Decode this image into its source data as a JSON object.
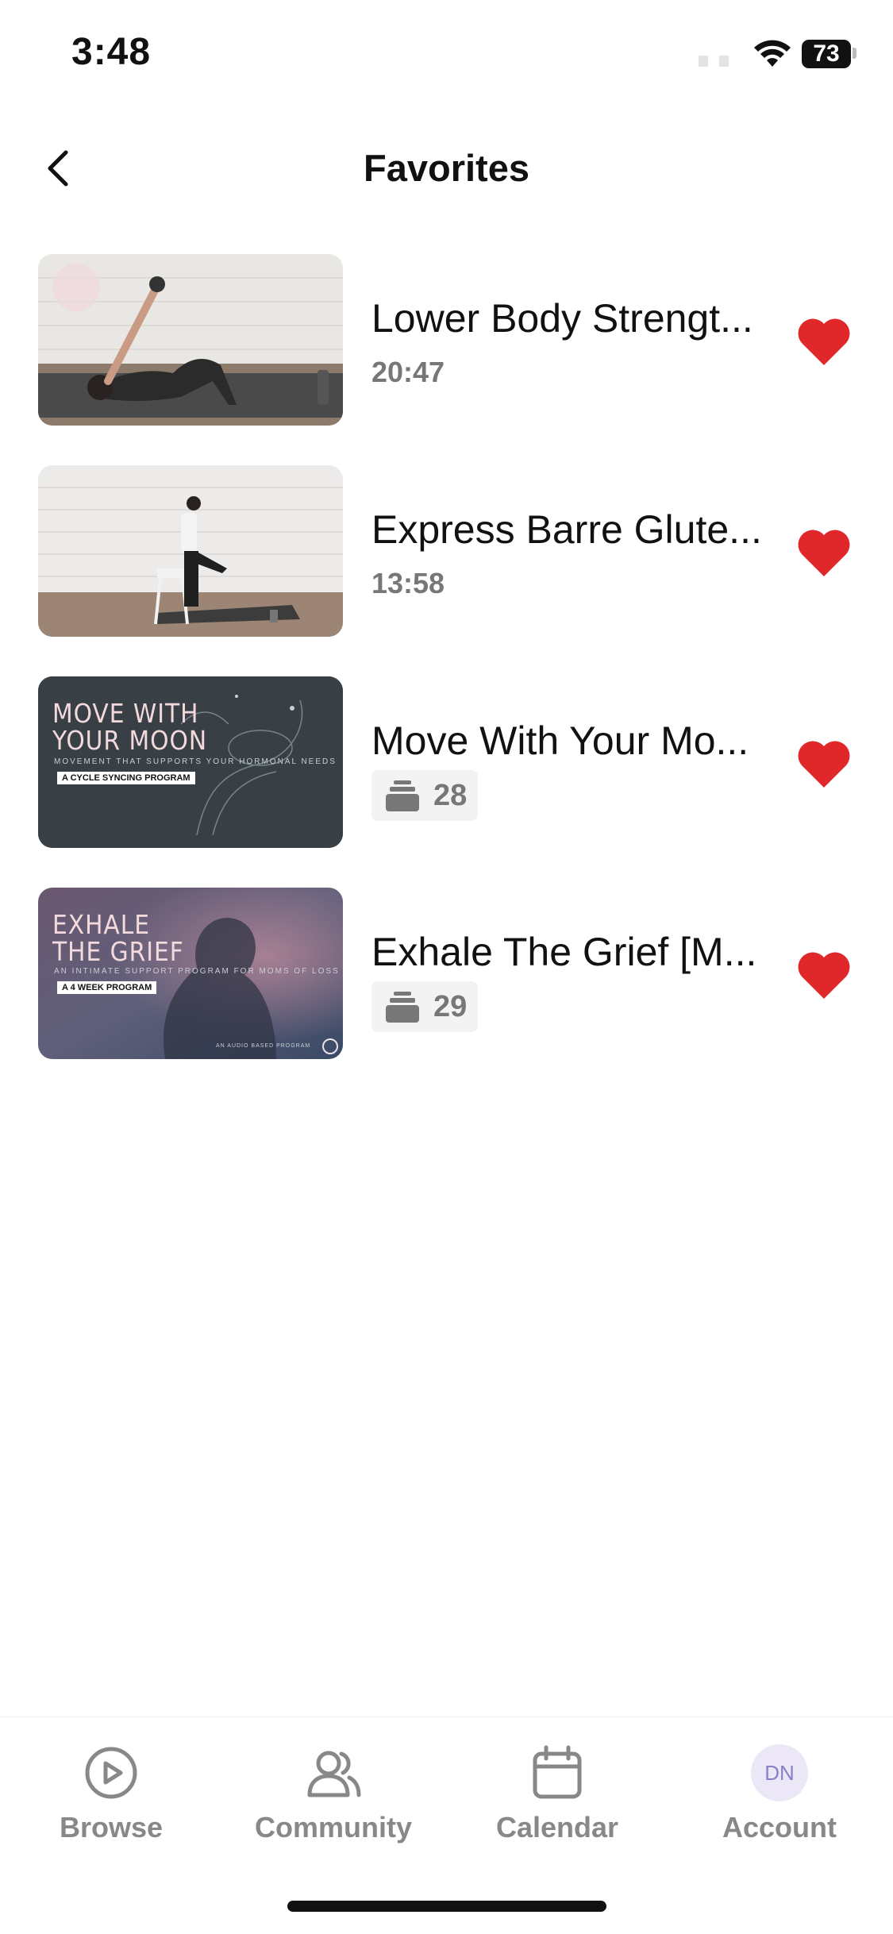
{
  "status_bar": {
    "time": "3:48",
    "battery": "73"
  },
  "header": {
    "title": "Favorites"
  },
  "favorites": [
    {
      "title": "Lower Body Strengt...",
      "duration": "20:47",
      "type": "video"
    },
    {
      "title": "Express Barre Glute...",
      "duration": "13:58",
      "type": "video"
    },
    {
      "title": "Move With Your Mo...",
      "count": "28",
      "type": "program",
      "thumb_line1": "MOVE WITH",
      "thumb_line2": "YOUR MOON",
      "thumb_sub": "MOVEMENT THAT SUPPORTS YOUR HORMONAL NEEDS",
      "thumb_tag": "A CYCLE SYNCING PROGRAM"
    },
    {
      "title": "Exhale The Grief [M...",
      "count": "29",
      "type": "program",
      "thumb_line1": "EXHALE",
      "thumb_line2": "THE GRIEF",
      "thumb_sub": "AN INTIMATE SUPPORT PROGRAM FOR MOMS OF LOSS",
      "thumb_tag": "A 4 WEEK PROGRAM",
      "thumb_footer": "AN AUDIO BASED PROGRAM"
    }
  ],
  "tabs": [
    {
      "label": "Browse",
      "icon": "play-circle-icon"
    },
    {
      "label": "Community",
      "icon": "users-icon"
    },
    {
      "label": "Calendar",
      "icon": "calendar-icon"
    },
    {
      "label": "Account",
      "icon": "avatar",
      "initials": "DN"
    }
  ],
  "colors": {
    "heart": "#e0282a",
    "tab_inactive": "#888888",
    "avatar_bg": "#ece7f6"
  }
}
